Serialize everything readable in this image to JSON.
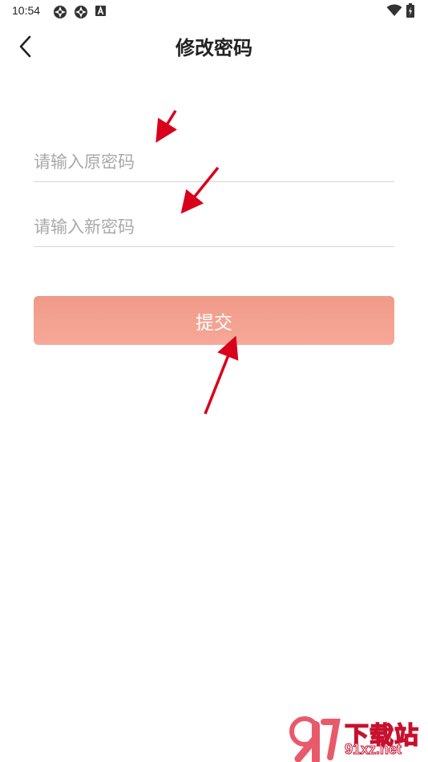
{
  "status_bar": {
    "time": "10:54",
    "icons": [
      "gear-icon",
      "gear-icon",
      "a-icon"
    ],
    "right_icons": [
      "wifi-icon",
      "battery-icon"
    ]
  },
  "header": {
    "title": "修改密码",
    "back_icon": "chevron-left-icon"
  },
  "form": {
    "old_password": {
      "placeholder": "请输入原密码",
      "value": ""
    },
    "new_password": {
      "placeholder": "请输入新密码",
      "value": ""
    },
    "submit_label": "提交"
  },
  "colors": {
    "submit_button": "#f4a08f",
    "annotation_arrow": "#d9001b",
    "divider": "#d6d6d6"
  },
  "watermark": {
    "logo_text": "91",
    "cn_text": "下载站",
    "url_text": "91xz.net"
  }
}
